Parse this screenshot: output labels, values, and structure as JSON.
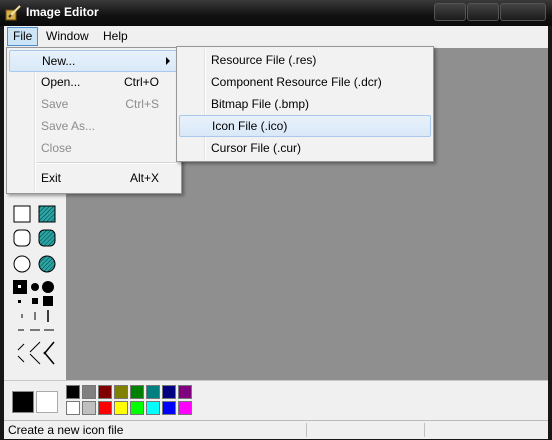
{
  "window": {
    "title": "Image Editor"
  },
  "menubar": {
    "items": [
      "File",
      "Window",
      "Help"
    ]
  },
  "file_menu": {
    "items": [
      {
        "label": "New...",
        "shortcut": "",
        "enabled": true,
        "submenu": true
      },
      {
        "label": "Open...",
        "shortcut": "Ctrl+O",
        "enabled": true
      },
      {
        "label": "Save",
        "shortcut": "Ctrl+S",
        "enabled": false
      },
      {
        "label": "Save As...",
        "shortcut": "",
        "enabled": false
      },
      {
        "label": "Close",
        "shortcut": "",
        "enabled": false
      },
      {
        "label": "Exit",
        "shortcut": "Alt+X",
        "enabled": true
      }
    ]
  },
  "new_submenu": {
    "items": [
      "Resource File (.res)",
      "Component Resource File (.dcr)",
      "Bitmap File (.bmp)",
      "Icon File (.ico)",
      "Cursor File (.cur)"
    ],
    "highlighted_index": 3
  },
  "palette": {
    "foreground": "#000000",
    "background": "#ffffff",
    "colors_top": [
      "#000000",
      "#808080",
      "#800000",
      "#808000",
      "#008000",
      "#008080",
      "#000080",
      "#800080"
    ],
    "colors_bottom": [
      "#ffffff",
      "#c0c0c0",
      "#ff0000",
      "#ffff00",
      "#00ff00",
      "#00ffff",
      "#0000ff",
      "#ff00ff"
    ]
  },
  "status": {
    "text": "Create a new icon file"
  }
}
